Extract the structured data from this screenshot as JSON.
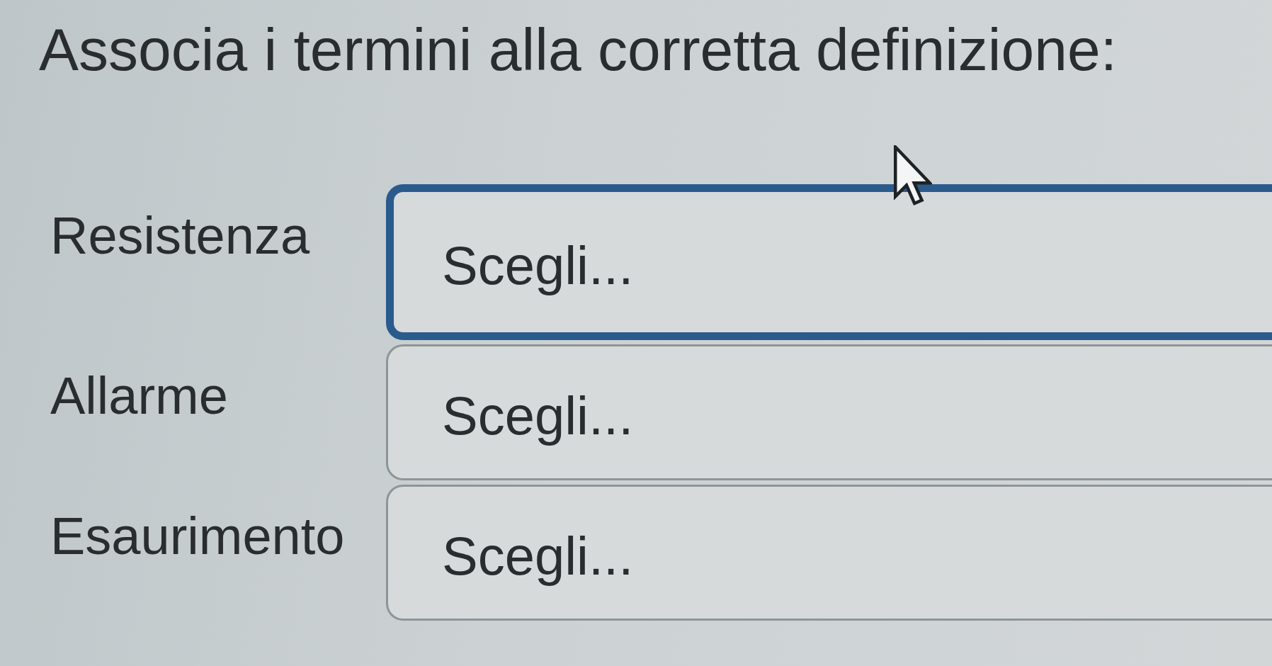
{
  "instruction": "Associa i termini alla corretta definizione:",
  "rows": [
    {
      "term": "Resistenza",
      "answer": {
        "value": "Scegli...",
        "focused": true
      }
    },
    {
      "term": "Allarme",
      "answer": {
        "value": "Scegli...",
        "focused": false
      }
    },
    {
      "term": "Esaurimento",
      "answer": {
        "value": "Scegli...",
        "focused": false
      }
    }
  ]
}
